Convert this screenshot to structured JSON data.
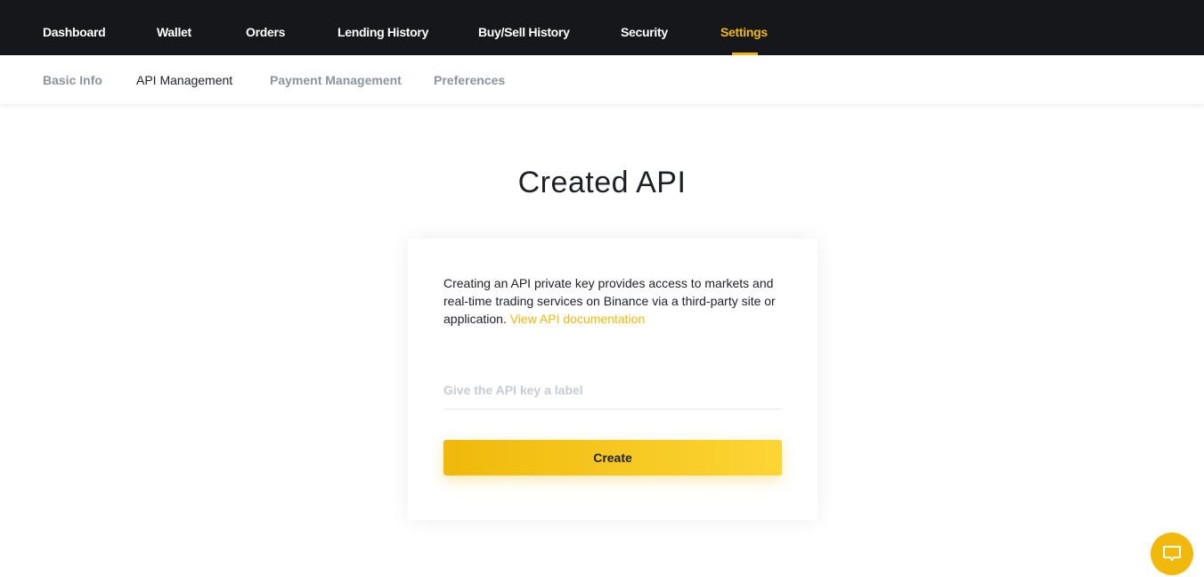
{
  "top_nav": {
    "items": [
      {
        "label": "Dashboard",
        "active": false
      },
      {
        "label": "Wallet",
        "active": false
      },
      {
        "label": "Orders",
        "active": false
      },
      {
        "label": "Lending History",
        "active": false
      },
      {
        "label": "Buy/Sell History",
        "active": false
      },
      {
        "label": "Security",
        "active": false
      },
      {
        "label": "Settings",
        "active": true
      }
    ]
  },
  "sub_nav": {
    "items": [
      {
        "label": "Basic Info",
        "active": false
      },
      {
        "label": "API Management",
        "active": true
      },
      {
        "label": "Payment Management",
        "active": false
      },
      {
        "label": "Preferences",
        "active": false
      }
    ]
  },
  "main": {
    "title": "Created API",
    "description": "Creating an API private key provides access to markets and real-time trading services on Binance via a third-party site or application.",
    "doc_link": "View API documentation",
    "label_input": {
      "value": "",
      "placeholder": "Give the API key a label"
    },
    "create_button": "Create"
  },
  "chat_button": {
    "icon": "chat-bubble-icon"
  },
  "colors": {
    "accent": "#f0b90b",
    "nav_bg": "#16171b"
  }
}
